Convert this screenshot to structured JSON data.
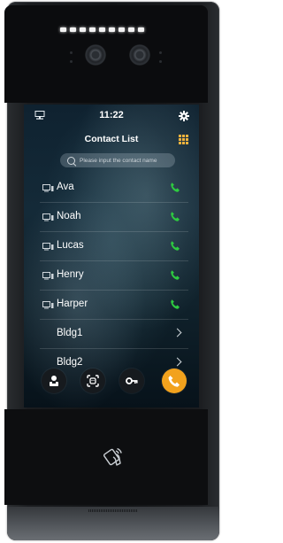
{
  "device": {
    "led_count": 9,
    "colors": {
      "screen_accent": "#f2a21d",
      "phone_icon": "#2ecc40",
      "grid_icon": "#f2b33d"
    }
  },
  "status_bar": {
    "time": "11:22",
    "left_icon": "network-icon",
    "right_icon": "gear-icon"
  },
  "header": {
    "title": "Contact List",
    "right_icon": "keypad-grid-icon"
  },
  "search": {
    "placeholder": "Please input the contact name",
    "value": ""
  },
  "contacts": [
    {
      "name": "Ava",
      "icon": "indoor-monitor-icon",
      "action_icon": "call-icon"
    },
    {
      "name": "Noah",
      "icon": "indoor-monitor-icon",
      "action_icon": "call-icon"
    },
    {
      "name": "Lucas",
      "icon": "indoor-monitor-icon",
      "action_icon": "call-icon"
    },
    {
      "name": "Henry",
      "icon": "indoor-monitor-icon",
      "action_icon": "call-icon"
    },
    {
      "name": "Harper",
      "icon": "indoor-monitor-icon",
      "action_icon": "call-icon"
    }
  ],
  "buildings": [
    {
      "name": "Bldg1",
      "action_icon": "chevron-right-icon"
    },
    {
      "name": "Bldg2",
      "action_icon": "chevron-right-icon"
    }
  ],
  "bottom_bar": [
    {
      "icon": "concierge-icon"
    },
    {
      "icon": "face-scan-icon"
    },
    {
      "icon": "key-icon"
    },
    {
      "icon": "call-icon"
    }
  ],
  "lower_panel": {
    "icon": "nfc-card-icon"
  }
}
